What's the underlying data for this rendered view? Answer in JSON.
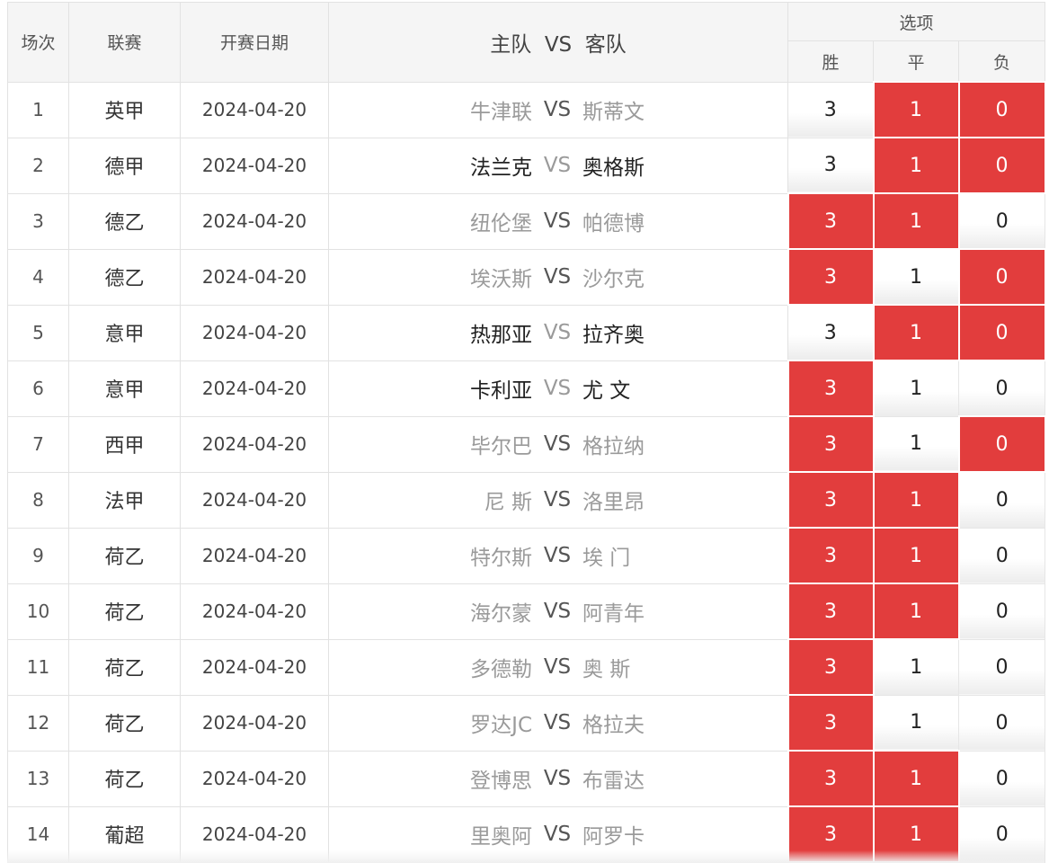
{
  "header": {
    "col_index": "场次",
    "col_league": "联赛",
    "col_date": "开赛日期",
    "col_home": "主队",
    "col_vs": "VS",
    "col_away": "客队",
    "col_options": "选项",
    "opt_win": "胜",
    "opt_draw": "平",
    "opt_loss": "负"
  },
  "colors": {
    "selected": "#e23d3d",
    "muted_text": "#9a9a9a",
    "header_bg": "#f5f5f5"
  },
  "rows": [
    {
      "idx": "1",
      "league": "英甲",
      "date": "2024-04-20",
      "home": "牛津联",
      "vs": "VS",
      "away": "斯蒂文",
      "home_style": "muted",
      "away_style": "muted",
      "vs_style": "darkvs",
      "win": "3",
      "draw": "1",
      "loss": "0",
      "win_sel": false,
      "draw_sel": true,
      "loss_sel": true
    },
    {
      "idx": "2",
      "league": "德甲",
      "date": "2024-04-20",
      "home": "法兰克",
      "vs": "VS",
      "away": "奥格斯",
      "home_style": "dark",
      "away_style": "dark",
      "vs_style": "muted",
      "win": "3",
      "draw": "1",
      "loss": "0",
      "win_sel": false,
      "draw_sel": true,
      "loss_sel": true
    },
    {
      "idx": "3",
      "league": "德乙",
      "date": "2024-04-20",
      "home": "纽伦堡",
      "vs": "VS",
      "away": "帕德博",
      "home_style": "muted",
      "away_style": "muted",
      "vs_style": "darkvs",
      "win": "3",
      "draw": "1",
      "loss": "0",
      "win_sel": true,
      "draw_sel": true,
      "loss_sel": false
    },
    {
      "idx": "4",
      "league": "德乙",
      "date": "2024-04-20",
      "home": "埃沃斯",
      "vs": "VS",
      "away": "沙尔克",
      "home_style": "muted",
      "away_style": "muted",
      "vs_style": "darkvs",
      "win": "3",
      "draw": "1",
      "loss": "0",
      "win_sel": true,
      "draw_sel": false,
      "loss_sel": true
    },
    {
      "idx": "5",
      "league": "意甲",
      "date": "2024-04-20",
      "home": "热那亚",
      "vs": "VS",
      "away": "拉齐奥",
      "home_style": "dark",
      "away_style": "dark",
      "vs_style": "muted",
      "win": "3",
      "draw": "1",
      "loss": "0",
      "win_sel": false,
      "draw_sel": true,
      "loss_sel": true
    },
    {
      "idx": "6",
      "league": "意甲",
      "date": "2024-04-20",
      "home": "卡利亚",
      "vs": "VS",
      "away": "尤 文",
      "home_style": "dark",
      "away_style": "dark",
      "vs_style": "muted",
      "win": "3",
      "draw": "1",
      "loss": "0",
      "win_sel": true,
      "draw_sel": false,
      "loss_sel": false
    },
    {
      "idx": "7",
      "league": "西甲",
      "date": "2024-04-20",
      "home": "毕尔巴",
      "vs": "VS",
      "away": "格拉纳",
      "home_style": "muted",
      "away_style": "muted",
      "vs_style": "darkvs",
      "win": "3",
      "draw": "1",
      "loss": "0",
      "win_sel": true,
      "draw_sel": false,
      "loss_sel": true
    },
    {
      "idx": "8",
      "league": "法甲",
      "date": "2024-04-20",
      "home": "尼 斯",
      "vs": "VS",
      "away": "洛里昂",
      "home_style": "muted",
      "away_style": "muted",
      "vs_style": "darkvs",
      "win": "3",
      "draw": "1",
      "loss": "0",
      "win_sel": true,
      "draw_sel": true,
      "loss_sel": false
    },
    {
      "idx": "9",
      "league": "荷乙",
      "date": "2024-04-20",
      "home": "特尔斯",
      "vs": "VS",
      "away": "埃 门",
      "home_style": "muted",
      "away_style": "muted",
      "vs_style": "darkvs",
      "win": "3",
      "draw": "1",
      "loss": "0",
      "win_sel": true,
      "draw_sel": true,
      "loss_sel": false
    },
    {
      "idx": "10",
      "league": "荷乙",
      "date": "2024-04-20",
      "home": "海尔蒙",
      "vs": "VS",
      "away": "阿青年",
      "home_style": "muted",
      "away_style": "muted",
      "vs_style": "darkvs",
      "win": "3",
      "draw": "1",
      "loss": "0",
      "win_sel": true,
      "draw_sel": true,
      "loss_sel": false
    },
    {
      "idx": "11",
      "league": "荷乙",
      "date": "2024-04-20",
      "home": "多德勒",
      "vs": "VS",
      "away": "奥 斯",
      "home_style": "muted",
      "away_style": "muted",
      "vs_style": "darkvs",
      "win": "3",
      "draw": "1",
      "loss": "0",
      "win_sel": true,
      "draw_sel": false,
      "loss_sel": false
    },
    {
      "idx": "12",
      "league": "荷乙",
      "date": "2024-04-20",
      "home": "罗达JC",
      "vs": "VS",
      "away": "格拉夫",
      "home_style": "muted",
      "away_style": "muted",
      "vs_style": "darkvs",
      "win": "3",
      "draw": "1",
      "loss": "0",
      "win_sel": true,
      "draw_sel": false,
      "loss_sel": false
    },
    {
      "idx": "13",
      "league": "荷乙",
      "date": "2024-04-20",
      "home": "登博思",
      "vs": "VS",
      "away": "布雷达",
      "home_style": "muted",
      "away_style": "muted",
      "vs_style": "darkvs",
      "win": "3",
      "draw": "1",
      "loss": "0",
      "win_sel": true,
      "draw_sel": true,
      "loss_sel": false
    },
    {
      "idx": "14",
      "league": "葡超",
      "date": "2024-04-20",
      "home": "里奥阿",
      "vs": "VS",
      "away": "阿罗卡",
      "home_style": "muted",
      "away_style": "muted",
      "vs_style": "darkvs",
      "win": "3",
      "draw": "1",
      "loss": "0",
      "win_sel": true,
      "draw_sel": true,
      "loss_sel": false
    }
  ]
}
